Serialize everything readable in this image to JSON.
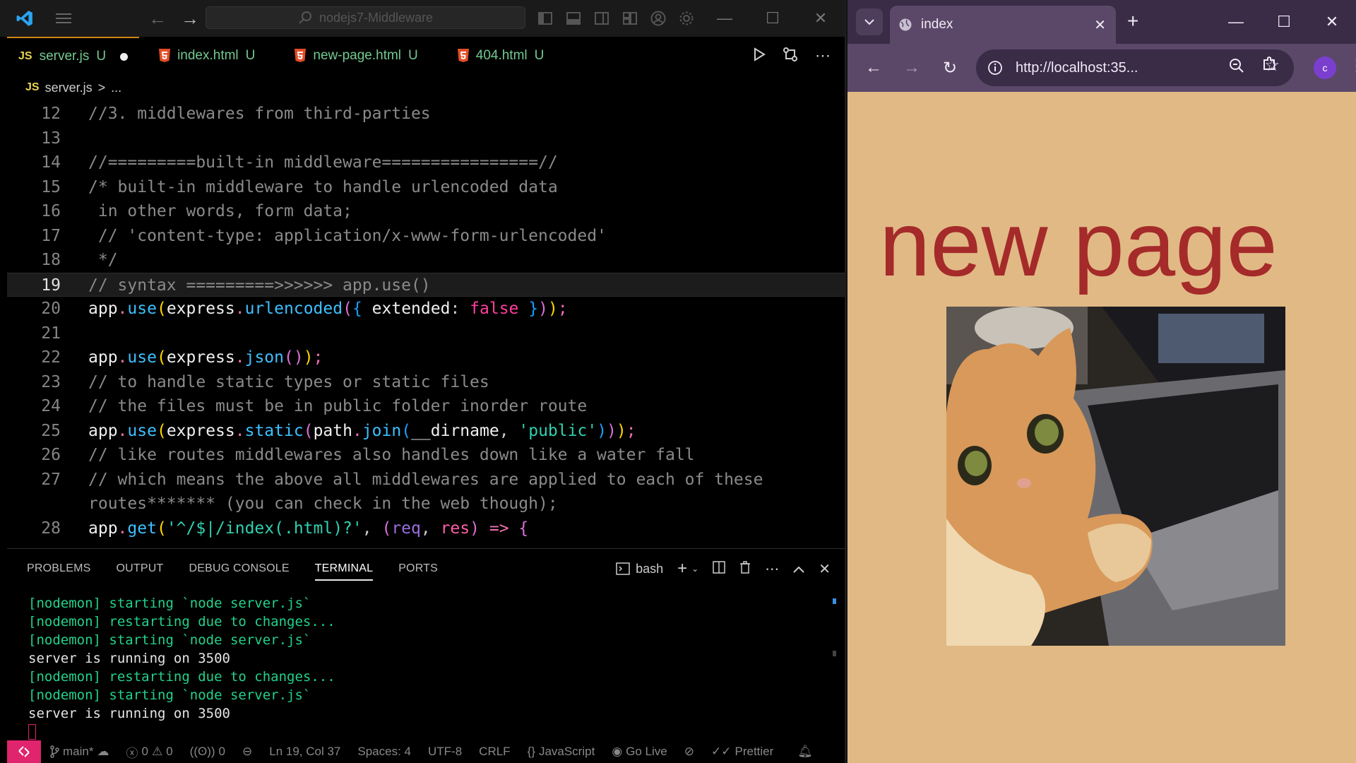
{
  "vscode": {
    "search_text": "nodejs7-Middleware",
    "tabs": [
      {
        "label": "server.js",
        "status": "U",
        "kind": "js",
        "active": true
      },
      {
        "label": "index.html",
        "status": "U",
        "kind": "html"
      },
      {
        "label": "new-page.html",
        "status": "U",
        "kind": "html"
      },
      {
        "label": "404.html",
        "status": "U",
        "kind": "html"
      }
    ],
    "breadcrumb": {
      "file": "server.js",
      "sep": ">",
      "rest": "..."
    },
    "code_lines": [
      {
        "n": "12",
        "text": "//3. middlewares from third-parties"
      },
      {
        "n": "13",
        "text": ""
      },
      {
        "n": "14",
        "text": "//=========built-in middleware================//"
      },
      {
        "n": "15",
        "text": "/* built-in middleware to handle urlencoded data"
      },
      {
        "n": "16",
        "text": " in other words, form data;"
      },
      {
        "n": "17",
        "text": " // 'content-type: application/x-www-form-urlencoded'"
      },
      {
        "n": "18",
        "text": " */"
      },
      {
        "n": "19",
        "text": "// syntax =========>>>>>> app.use()"
      },
      {
        "n": "20",
        "text": "app.use(express.urlencoded({ extended: false }));"
      },
      {
        "n": "21",
        "text": ""
      },
      {
        "n": "22",
        "text": "app.use(express.json());"
      },
      {
        "n": "23",
        "text": "// to handle static types or static files"
      },
      {
        "n": "24",
        "text": "// the files must be in public folder inorder route"
      },
      {
        "n": "25",
        "text": "app.use(express.static(path.join(__dirname, 'public')));"
      },
      {
        "n": "26",
        "text": "// like routes middlewares also handles down like a water fall"
      },
      {
        "n": "27",
        "text": "// which means the above all middlewares are applied to each of these"
      },
      {
        "n": "",
        "text": "routes******* (you can check in the web though);"
      },
      {
        "n": "28",
        "text": "app.get('^/$|/index(.html)?', (req, res) => {"
      }
    ],
    "panel_tabs": [
      "PROBLEMS",
      "OUTPUT",
      "DEBUG CONSOLE",
      "TERMINAL",
      "PORTS"
    ],
    "active_panel_tab": "TERMINAL",
    "shell": "bash",
    "terminal_lines": [
      {
        "text": "[nodemon] starting `node server.js`",
        "color": "#23d18b"
      },
      {
        "text": "[nodemon] restarting due to changes...",
        "color": "#23d18b"
      },
      {
        "text": "[nodemon] starting `node server.js`",
        "color": "#23d18b"
      },
      {
        "text": "server is running on 3500",
        "color": "#e5e5e5"
      },
      {
        "text": "[nodemon] restarting due to changes...",
        "color": "#23d18b"
      },
      {
        "text": "[nodemon] starting `node server.js`",
        "color": "#23d18b"
      },
      {
        "text": "server is running on 3500",
        "color": "#e5e5e5"
      }
    ],
    "statusbar": {
      "branch": "main*",
      "errors": "0",
      "warnings": "0",
      "ports": "0",
      "position": "Ln 19, Col 37",
      "spaces": "Spaces: 4",
      "encoding": "UTF-8",
      "eol": "CRLF",
      "language": "JavaScript",
      "golive": "Go Live",
      "prettier": "Prettier"
    },
    "colors": {
      "accent": "#e0246e",
      "js": "#e8d44d",
      "untracked": "#73c991"
    }
  },
  "browser": {
    "tab_title": "index",
    "url": "http://localhost:35...",
    "profile_initial": "c",
    "page_heading": "new page",
    "image_alt": "cat at laptop",
    "colors": {
      "page_bg": "#e1b985",
      "heading": "#a52a2a",
      "chrome": "#5b4868"
    }
  }
}
